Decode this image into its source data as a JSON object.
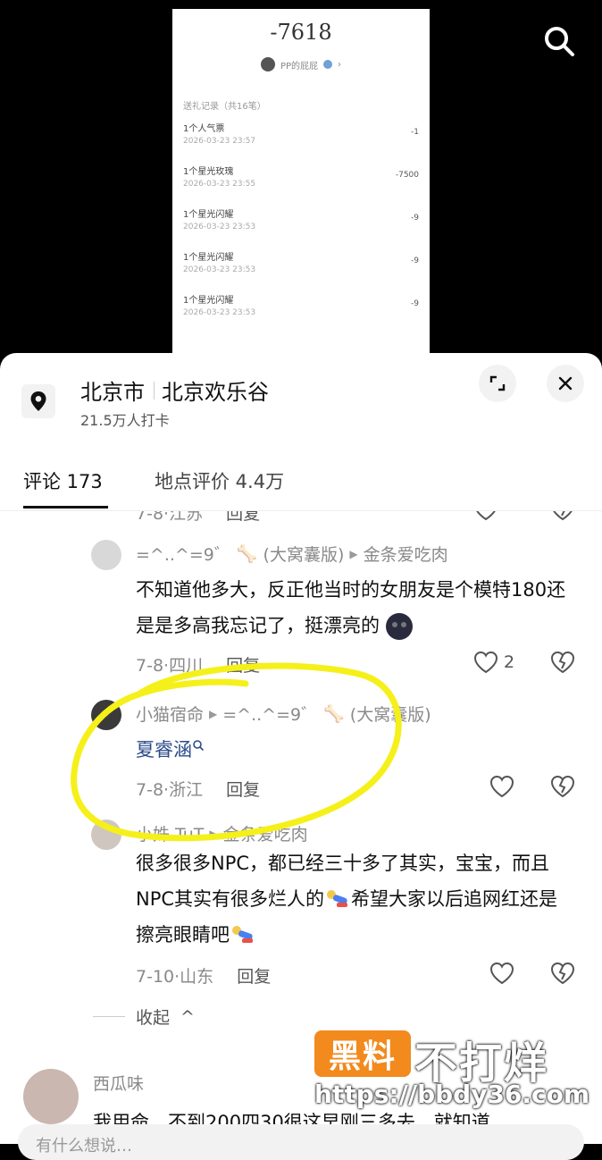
{
  "receipt": {
    "amount": "-7618",
    "user_name": "PP的屁屁",
    "records_header": "送礼记录（共16笔）",
    "records": [
      {
        "name": "1个人气票",
        "time": "2026-03-23 23:57",
        "value": "-1"
      },
      {
        "name": "1个星光玫瑰",
        "time": "2026-03-23 23:55",
        "value": "-7500"
      },
      {
        "name": "1个星光闪耀",
        "time": "2026-03-23 23:53",
        "value": "-9"
      },
      {
        "name": "1个星光闪耀",
        "time": "2026-03-23 23:53",
        "value": "-9"
      },
      {
        "name": "1个星光闪耀",
        "time": "2026-03-23 23:53",
        "value": "-9"
      }
    ]
  },
  "location": {
    "city": "北京市",
    "place": "北京欢乐谷",
    "checkins": "21.5万人打卡"
  },
  "tabs": [
    {
      "label": "评论 173"
    },
    {
      "label": "地点评价 4.4万"
    }
  ],
  "comments": [
    {
      "date": "7-8",
      "region": "江苏",
      "reply": "回复"
    },
    {
      "user": "=^..^=9゛",
      "tag": "(大窝囊版)",
      "reply_to": "金条爱吃肉",
      "text": "不知道他多大，反正他当时的女朋友是个模特180还是是多高我忘记了，挺漂亮的",
      "date": "7-8",
      "region": "四川",
      "reply": "回复",
      "likes": "2"
    },
    {
      "user": "小猫宿命",
      "reply_to": "=^..^=9゛",
      "reply_to_tag": "(大窝囊版)",
      "text": "夏睿涵",
      "date": "7-8",
      "region": "浙江",
      "reply": "回复"
    },
    {
      "user": "小姝 TuT",
      "reply_to": "金条爱吃肉",
      "text_1": "很多很多NPC，都已经三十多了其实，宝宝，而且NPC其实有很多烂人的",
      "text_2": "希望大家以后追网红还是擦亮眼睛吧",
      "date": "7-10",
      "region": "山东",
      "reply": "回复"
    },
    {
      "user": "西瓜味",
      "text": "我用命…不到200四30很这早刚三多去…就知道"
    }
  ],
  "collapse_label": "收起",
  "watermark": {
    "box": "黑料",
    "text": "不打烊",
    "url": "https://bbdy36.com"
  },
  "input_placeholder": "有什么想说…"
}
